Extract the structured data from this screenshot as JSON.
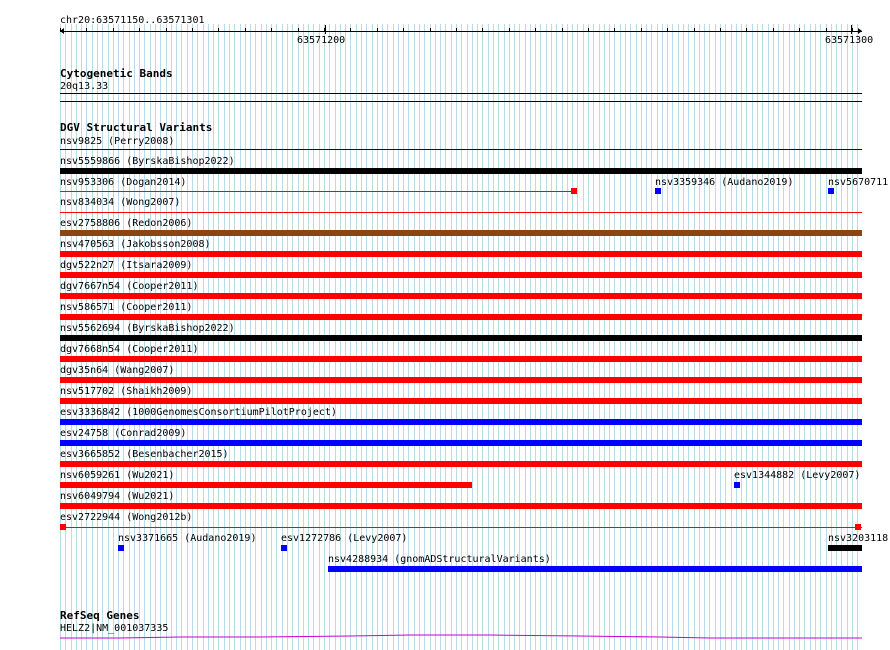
{
  "ruler": {
    "region": "chr20:63571150..63571301",
    "tick_left": "63571200",
    "tick_right": "63571300"
  },
  "cytobands": {
    "title": "Cytogenetic Bands",
    "band": "20q13.33"
  },
  "dgv": {
    "title": "DGV Structural Variants",
    "colors": {
      "black": "#000000",
      "red": "#ff0000",
      "brown": "#8b4513",
      "blue": "#0000ff",
      "track_line": "#00007f"
    },
    "features": [
      {
        "label": "nsv9825 (Perry2008)"
      },
      {
        "label": "nsv5559866 (ByrskaBishop2022)"
      },
      {
        "label": "nsv953306 (Dogan2014)"
      },
      {
        "label": "nsv3359346 (Audano2019)"
      },
      {
        "label": "nsv5670711"
      },
      {
        "label": "nsv834034 (Wong2007)"
      },
      {
        "label": "esv2758806 (Redon2006)"
      },
      {
        "label": "nsv470563 (Jakobsson2008)"
      },
      {
        "label": "dgv522n27 (Itsara2009)"
      },
      {
        "label": "dgv7667n54 (Cooper2011)"
      },
      {
        "label": "nsv586571 (Cooper2011)"
      },
      {
        "label": "nsv5562694 (ByrskaBishop2022)"
      },
      {
        "label": "dgv7668n54 (Cooper2011)"
      },
      {
        "label": "dgv35n64 (Wang2007)"
      },
      {
        "label": "nsv517702 (Shaikh2009)"
      },
      {
        "label": "esv3336842 (1000GenomesConsortiumPilotProject)"
      },
      {
        "label": "esv24758 (Conrad2009)"
      },
      {
        "label": "esv3665852 (Besenbacher2015)"
      },
      {
        "label": "nsv6059261 (Wu2021)"
      },
      {
        "label": "esv1344882 (Levy2007)"
      },
      {
        "label": "nsv6049794 (Wu2021)"
      },
      {
        "label": "esv2722944 (Wong2012b)"
      },
      {
        "label": "nsv3371665 (Audano2019)"
      },
      {
        "label": "esv1272786 (Levy2007)"
      },
      {
        "label": "nsv3203118"
      },
      {
        "label": "nsv4288934 (gnomADStructuralVariants)"
      }
    ]
  },
  "refseq": {
    "title": "RefSeq Genes",
    "gene": "HELZ2|NM_001037335",
    "color": "#cc00cc"
  }
}
